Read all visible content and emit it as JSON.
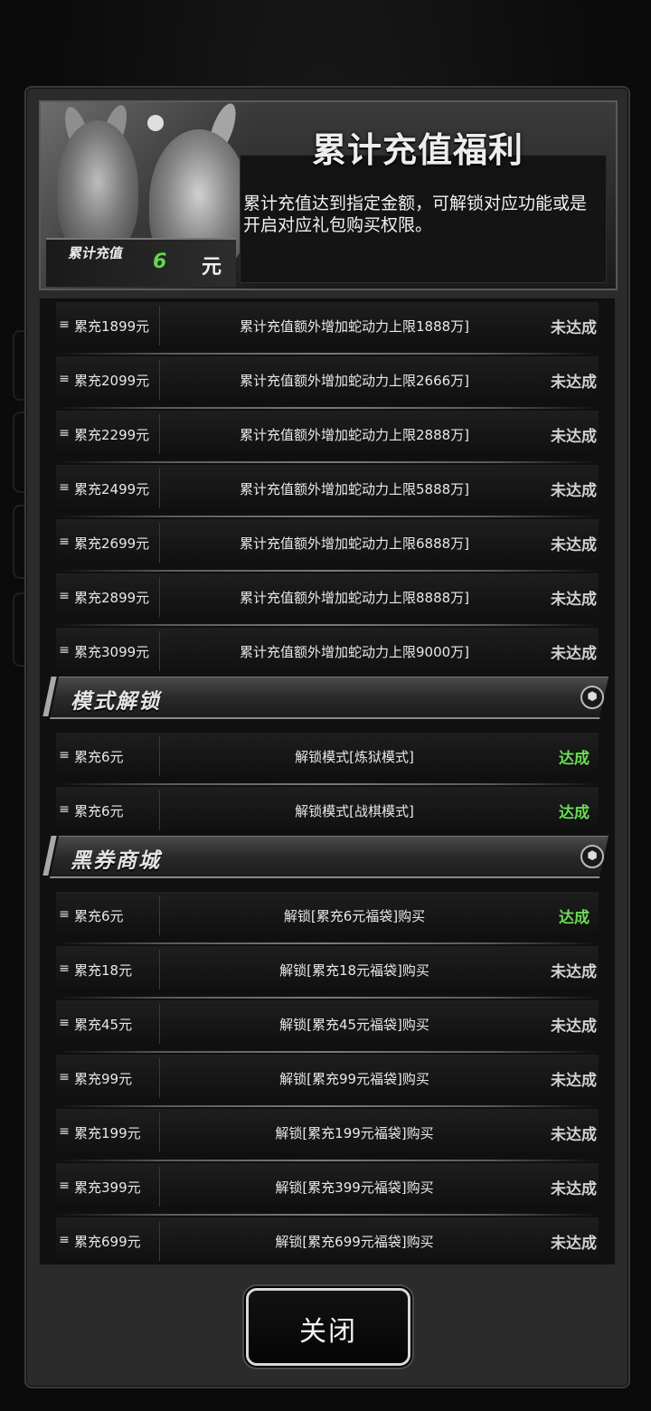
{
  "header": {
    "title": "累计充值福利",
    "description": "累计充值达到指定金额，可解锁对应功能或是开启对应礼包购买权限。",
    "total_label": "累计充值",
    "total_value": "6",
    "total_unit": "元"
  },
  "rows_group1": [
    {
      "amount": "累充1899元",
      "desc": "累计充值额外增加蛇动力上限1888万]",
      "status": "未达成"
    },
    {
      "amount": "累充2099元",
      "desc": "累计充值额外增加蛇动力上限2666万]",
      "status": "未达成"
    },
    {
      "amount": "累充2299元",
      "desc": "累计充值额外增加蛇动力上限2888万]",
      "status": "未达成"
    },
    {
      "amount": "累充2499元",
      "desc": "累计充值额外增加蛇动力上限5888万]",
      "status": "未达成"
    },
    {
      "amount": "累充2699元",
      "desc": "累计充值额外增加蛇动力上限6888万]",
      "status": "未达成"
    },
    {
      "amount": "累充2899元",
      "desc": "累计充值额外增加蛇动力上限8888万]",
      "status": "未达成"
    },
    {
      "amount": "累充3099元",
      "desc": "累计充值额外增加蛇动力上限9000万]",
      "status": "未达成"
    }
  ],
  "section_mode": {
    "title": "模式解锁",
    "rows": [
      {
        "amount": "累充6元",
        "desc": "解锁模式[炼狱模式]",
        "status": "达成"
      },
      {
        "amount": "累充6元",
        "desc": "解锁模式[战棋模式]",
        "status": "达成"
      }
    ]
  },
  "section_shop": {
    "title": "黑券商城",
    "rows": [
      {
        "amount": "累充6元",
        "desc": "解锁[累充6元福袋]购买",
        "status": "达成"
      },
      {
        "amount": "累充18元",
        "desc": "解锁[累充18元福袋]购买",
        "status": "未达成"
      },
      {
        "amount": "累充45元",
        "desc": "解锁[累充45元福袋]购买",
        "status": "未达成"
      },
      {
        "amount": "累充99元",
        "desc": "解锁[累充99元福袋]购买",
        "status": "未达成"
      },
      {
        "amount": "累充199元",
        "desc": "解锁[累充199元福袋]购买",
        "status": "未达成"
      },
      {
        "amount": "累充399元",
        "desc": "解锁[累充399元福袋]购买",
        "status": "未达成"
      },
      {
        "amount": "累充699元",
        "desc": "解锁[累充699元福袋]购买",
        "status": "未达成"
      }
    ]
  },
  "close_button": {
    "label": "关闭"
  },
  "icons": {
    "row_icon": "stack-icon",
    "section_icon": "hexagon-icon"
  },
  "colors": {
    "achieved": "#6ddc58",
    "not_achieved": "#d2d2d2",
    "total_value": "#63d84a"
  }
}
